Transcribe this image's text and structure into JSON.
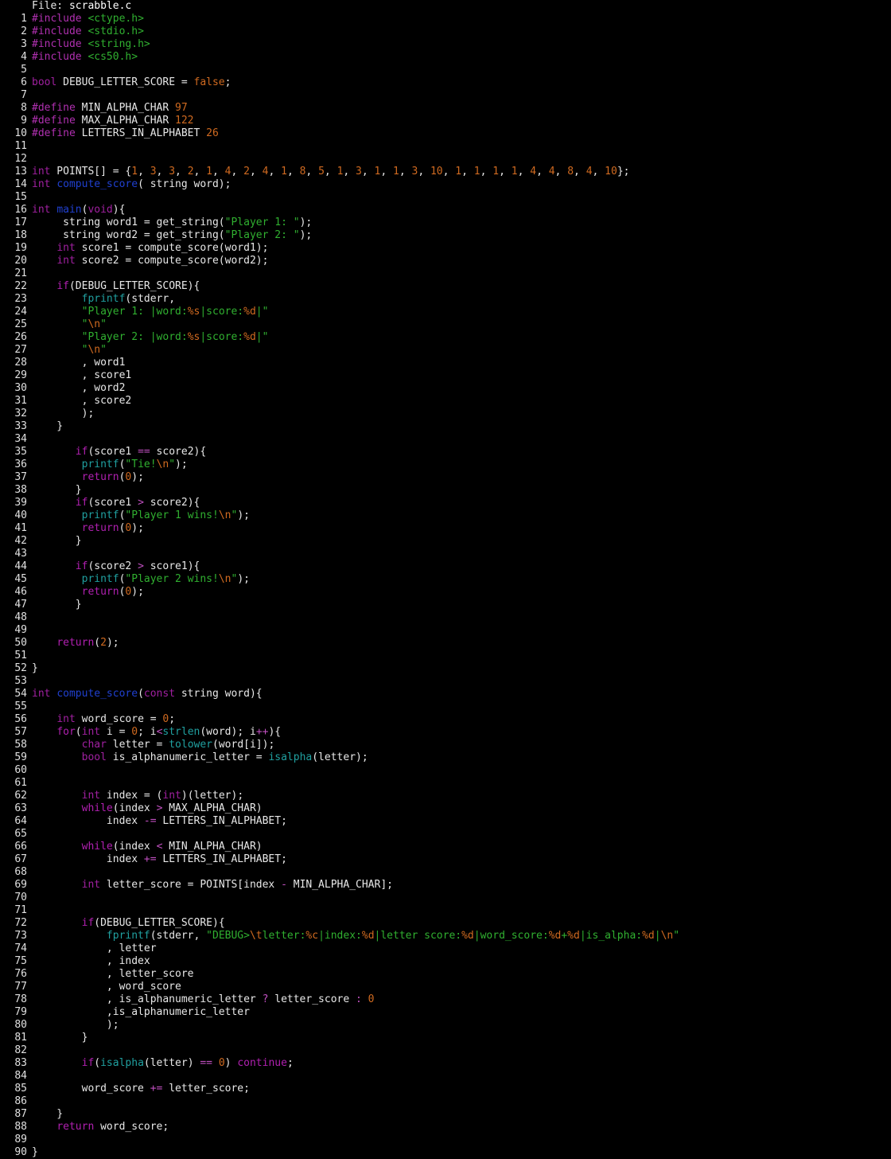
{
  "header": {
    "label": "File: ",
    "filename": "scrabble.c"
  },
  "colors": {
    "background": "#000000",
    "text": "#e8e8e8",
    "preprocessor": "#b030b0",
    "string": "#30b030",
    "number": "#d06a20",
    "type": "#a020a0",
    "function_decl": "#2040d0",
    "library_call": "#20a0a0"
  },
  "lines": [
    [
      [
        "pp",
        "#include "
      ],
      [
        "inc",
        "<ctype.h>"
      ]
    ],
    [
      [
        "pp",
        "#include "
      ],
      [
        "inc",
        "<stdio.h>"
      ]
    ],
    [
      [
        "pp",
        "#include "
      ],
      [
        "inc",
        "<string.h>"
      ]
    ],
    [
      [
        "pp",
        "#include "
      ],
      [
        "inc",
        "<cs50.h>"
      ]
    ],
    [],
    [
      [
        "type",
        "bool"
      ],
      [
        "id",
        " DEBUG_LETTER_SCORE = "
      ],
      [
        "num",
        "false"
      ],
      [
        "id",
        ";"
      ]
    ],
    [],
    [
      [
        "pp",
        "#define"
      ],
      [
        "id",
        " MIN_ALPHA_CHAR "
      ],
      [
        "num",
        "97"
      ]
    ],
    [
      [
        "pp",
        "#define"
      ],
      [
        "id",
        " MAX_ALPHA_CHAR "
      ],
      [
        "num",
        "122"
      ]
    ],
    [
      [
        "pp",
        "#define"
      ],
      [
        "id",
        " LETTERS_IN_ALPHABET "
      ],
      [
        "num",
        "26"
      ]
    ],
    [],
    [],
    [
      [
        "type",
        "int"
      ],
      [
        "id",
        " POINTS[] = {"
      ],
      [
        "num",
        "1"
      ],
      [
        "id",
        ", "
      ],
      [
        "num",
        "3"
      ],
      [
        "id",
        ", "
      ],
      [
        "num",
        "3"
      ],
      [
        "id",
        ", "
      ],
      [
        "num",
        "2"
      ],
      [
        "id",
        ", "
      ],
      [
        "num",
        "1"
      ],
      [
        "id",
        ", "
      ],
      [
        "num",
        "4"
      ],
      [
        "id",
        ", "
      ],
      [
        "num",
        "2"
      ],
      [
        "id",
        ", "
      ],
      [
        "num",
        "4"
      ],
      [
        "id",
        ", "
      ],
      [
        "num",
        "1"
      ],
      [
        "id",
        ", "
      ],
      [
        "num",
        "8"
      ],
      [
        "id",
        ", "
      ],
      [
        "num",
        "5"
      ],
      [
        "id",
        ", "
      ],
      [
        "num",
        "1"
      ],
      [
        "id",
        ", "
      ],
      [
        "num",
        "3"
      ],
      [
        "id",
        ", "
      ],
      [
        "num",
        "1"
      ],
      [
        "id",
        ", "
      ],
      [
        "num",
        "1"
      ],
      [
        "id",
        ", "
      ],
      [
        "num",
        "3"
      ],
      [
        "id",
        ", "
      ],
      [
        "num",
        "10"
      ],
      [
        "id",
        ", "
      ],
      [
        "num",
        "1"
      ],
      [
        "id",
        ", "
      ],
      [
        "num",
        "1"
      ],
      [
        "id",
        ", "
      ],
      [
        "num",
        "1"
      ],
      [
        "id",
        ", "
      ],
      [
        "num",
        "1"
      ],
      [
        "id",
        ", "
      ],
      [
        "num",
        "4"
      ],
      [
        "id",
        ", "
      ],
      [
        "num",
        "4"
      ],
      [
        "id",
        ", "
      ],
      [
        "num",
        "8"
      ],
      [
        "id",
        ", "
      ],
      [
        "num",
        "4"
      ],
      [
        "id",
        ", "
      ],
      [
        "num",
        "10"
      ],
      [
        "id",
        "};"
      ]
    ],
    [
      [
        "type",
        "int"
      ],
      [
        "id",
        " "
      ],
      [
        "fn",
        "compute_score"
      ],
      [
        "id",
        "( string word);"
      ]
    ],
    [],
    [
      [
        "type",
        "int"
      ],
      [
        "id",
        " "
      ],
      [
        "fn",
        "main"
      ],
      [
        "id",
        "("
      ],
      [
        "type",
        "void"
      ],
      [
        "id",
        "){"
      ]
    ],
    [
      [
        "id",
        "     string word1 = get_string("
      ],
      [
        "str",
        "\"Player 1: \""
      ],
      [
        "id",
        ");"
      ]
    ],
    [
      [
        "id",
        "     string word2 = get_string("
      ],
      [
        "str",
        "\"Player 2: \""
      ],
      [
        "id",
        ");"
      ]
    ],
    [
      [
        "id",
        "    "
      ],
      [
        "type",
        "int"
      ],
      [
        "id",
        " score1 = compute_score(word1);"
      ]
    ],
    [
      [
        "id",
        "    "
      ],
      [
        "type",
        "int"
      ],
      [
        "id",
        " score2 = compute_score(word2);"
      ]
    ],
    [],
    [
      [
        "id",
        "    "
      ],
      [
        "kw",
        "if"
      ],
      [
        "id",
        "(DEBUG_LETTER_SCORE){"
      ]
    ],
    [
      [
        "id",
        "        "
      ],
      [
        "lib",
        "fprintf"
      ],
      [
        "id",
        "(stderr,"
      ]
    ],
    [
      [
        "id",
        "        "
      ],
      [
        "str",
        "\"Player 1: |word:"
      ],
      [
        "esc",
        "%s"
      ],
      [
        "str",
        "|score:"
      ],
      [
        "esc",
        "%d"
      ],
      [
        "str",
        "|\""
      ]
    ],
    [
      [
        "id",
        "        "
      ],
      [
        "str",
        "\""
      ],
      [
        "esc",
        "\\n"
      ],
      [
        "str",
        "\""
      ]
    ],
    [
      [
        "id",
        "        "
      ],
      [
        "str",
        "\"Player 2: |word:"
      ],
      [
        "esc",
        "%s"
      ],
      [
        "str",
        "|score:"
      ],
      [
        "esc",
        "%d"
      ],
      [
        "str",
        "|\""
      ]
    ],
    [
      [
        "id",
        "        "
      ],
      [
        "str",
        "\""
      ],
      [
        "esc",
        "\\n"
      ],
      [
        "str",
        "\""
      ]
    ],
    [
      [
        "id",
        "        , word1"
      ]
    ],
    [
      [
        "id",
        "        , score1"
      ]
    ],
    [
      [
        "id",
        "        , word2"
      ]
    ],
    [
      [
        "id",
        "        , score2"
      ]
    ],
    [
      [
        "id",
        "        );"
      ]
    ],
    [
      [
        "id",
        "    }"
      ]
    ],
    [],
    [
      [
        "id",
        "       "
      ],
      [
        "kw",
        "if"
      ],
      [
        "id",
        "(score1 "
      ],
      [
        "op",
        "=="
      ],
      [
        "id",
        " score2){"
      ]
    ],
    [
      [
        "id",
        "        "
      ],
      [
        "lib",
        "printf"
      ],
      [
        "id",
        "("
      ],
      [
        "str",
        "\"Tie!"
      ],
      [
        "esc",
        "\\n"
      ],
      [
        "str",
        "\""
      ],
      [
        "id",
        ");"
      ]
    ],
    [
      [
        "id",
        "        "
      ],
      [
        "kw",
        "return"
      ],
      [
        "id",
        "("
      ],
      [
        "num",
        "0"
      ],
      [
        "id",
        ");"
      ]
    ],
    [
      [
        "id",
        "       }"
      ]
    ],
    [
      [
        "id",
        "       "
      ],
      [
        "kw",
        "if"
      ],
      [
        "id",
        "(score1 "
      ],
      [
        "op",
        ">"
      ],
      [
        "id",
        " score2){"
      ]
    ],
    [
      [
        "id",
        "        "
      ],
      [
        "lib",
        "printf"
      ],
      [
        "id",
        "("
      ],
      [
        "str",
        "\"Player 1 wins!"
      ],
      [
        "esc",
        "\\n"
      ],
      [
        "str",
        "\""
      ],
      [
        "id",
        ");"
      ]
    ],
    [
      [
        "id",
        "        "
      ],
      [
        "kw",
        "return"
      ],
      [
        "id",
        "("
      ],
      [
        "num",
        "0"
      ],
      [
        "id",
        ");"
      ]
    ],
    [
      [
        "id",
        "       }"
      ]
    ],
    [],
    [
      [
        "id",
        "       "
      ],
      [
        "kw",
        "if"
      ],
      [
        "id",
        "(score2 "
      ],
      [
        "op",
        ">"
      ],
      [
        "id",
        " score1){"
      ]
    ],
    [
      [
        "id",
        "        "
      ],
      [
        "lib",
        "printf"
      ],
      [
        "id",
        "("
      ],
      [
        "str",
        "\"Player 2 wins!"
      ],
      [
        "esc",
        "\\n"
      ],
      [
        "str",
        "\""
      ],
      [
        "id",
        ");"
      ]
    ],
    [
      [
        "id",
        "        "
      ],
      [
        "kw",
        "return"
      ],
      [
        "id",
        "("
      ],
      [
        "num",
        "0"
      ],
      [
        "id",
        ");"
      ]
    ],
    [
      [
        "id",
        "       }"
      ]
    ],
    [],
    [],
    [
      [
        "id",
        "    "
      ],
      [
        "kw",
        "return"
      ],
      [
        "id",
        "("
      ],
      [
        "num",
        "2"
      ],
      [
        "id",
        ");"
      ]
    ],
    [],
    [
      [
        "id",
        "}"
      ]
    ],
    [],
    [
      [
        "type",
        "int"
      ],
      [
        "id",
        " "
      ],
      [
        "fn",
        "compute_score"
      ],
      [
        "id",
        "("
      ],
      [
        "type",
        "const"
      ],
      [
        "id",
        " string word){"
      ]
    ],
    [],
    [
      [
        "id",
        "    "
      ],
      [
        "type",
        "int"
      ],
      [
        "id",
        " word_score = "
      ],
      [
        "num",
        "0"
      ],
      [
        "id",
        ";"
      ]
    ],
    [
      [
        "id",
        "    "
      ],
      [
        "kw",
        "for"
      ],
      [
        "id",
        "("
      ],
      [
        "type",
        "int"
      ],
      [
        "id",
        " i = "
      ],
      [
        "num",
        "0"
      ],
      [
        "id",
        "; i"
      ],
      [
        "op",
        "<"
      ],
      [
        "lib",
        "strlen"
      ],
      [
        "id",
        "(word); i"
      ],
      [
        "op",
        "++"
      ],
      [
        "id",
        "){"
      ]
    ],
    [
      [
        "id",
        "        "
      ],
      [
        "type",
        "char"
      ],
      [
        "id",
        " letter = "
      ],
      [
        "lib",
        "tolower"
      ],
      [
        "id",
        "(word[i]);"
      ]
    ],
    [
      [
        "id",
        "        "
      ],
      [
        "type",
        "bool"
      ],
      [
        "id",
        " is_alphanumeric_letter = "
      ],
      [
        "lib",
        "isalpha"
      ],
      [
        "id",
        "(letter);"
      ]
    ],
    [],
    [],
    [
      [
        "id",
        "        "
      ],
      [
        "type",
        "int"
      ],
      [
        "id",
        " index = ("
      ],
      [
        "type",
        "int"
      ],
      [
        "id",
        ")(letter);"
      ]
    ],
    [
      [
        "id",
        "        "
      ],
      [
        "kw",
        "while"
      ],
      [
        "id",
        "(index "
      ],
      [
        "op",
        ">"
      ],
      [
        "id",
        " MAX_ALPHA_CHAR)"
      ]
    ],
    [
      [
        "id",
        "            index "
      ],
      [
        "op",
        "-="
      ],
      [
        "id",
        " LETTERS_IN_ALPHABET;"
      ]
    ],
    [],
    [
      [
        "id",
        "        "
      ],
      [
        "kw",
        "while"
      ],
      [
        "id",
        "(index "
      ],
      [
        "op",
        "<"
      ],
      [
        "id",
        " MIN_ALPHA_CHAR)"
      ]
    ],
    [
      [
        "id",
        "            index "
      ],
      [
        "op",
        "+="
      ],
      [
        "id",
        " LETTERS_IN_ALPHABET;"
      ]
    ],
    [],
    [
      [
        "id",
        "        "
      ],
      [
        "type",
        "int"
      ],
      [
        "id",
        " letter_score = POINTS[index "
      ],
      [
        "op",
        "-"
      ],
      [
        "id",
        " MIN_ALPHA_CHAR];"
      ]
    ],
    [],
    [],
    [
      [
        "id",
        "        "
      ],
      [
        "kw",
        "if"
      ],
      [
        "id",
        "(DEBUG_LETTER_SCORE){"
      ]
    ],
    [
      [
        "id",
        "            "
      ],
      [
        "lib",
        "fprintf"
      ],
      [
        "id",
        "(stderr, "
      ],
      [
        "str",
        "\"DEBUG>"
      ],
      [
        "esc",
        "\\t"
      ],
      [
        "str",
        "letter:"
      ],
      [
        "esc",
        "%c"
      ],
      [
        "str",
        "|index:"
      ],
      [
        "esc",
        "%d"
      ],
      [
        "str",
        "|letter score:"
      ],
      [
        "esc",
        "%d"
      ],
      [
        "str",
        "|word_score:"
      ],
      [
        "esc",
        "%d"
      ],
      [
        "str",
        "+"
      ],
      [
        "esc",
        "%d"
      ],
      [
        "str",
        "|is_alpha:"
      ],
      [
        "esc",
        "%d"
      ],
      [
        "str",
        "|"
      ],
      [
        "esc",
        "\\n"
      ],
      [
        "str",
        "\""
      ]
    ],
    [
      [
        "id",
        "            , letter"
      ]
    ],
    [
      [
        "id",
        "            , index"
      ]
    ],
    [
      [
        "id",
        "            , letter_score"
      ]
    ],
    [
      [
        "id",
        "            , word_score"
      ]
    ],
    [
      [
        "id",
        "            , is_alphanumeric_letter "
      ],
      [
        "op",
        "?"
      ],
      [
        "id",
        " letter_score "
      ],
      [
        "op",
        ":"
      ],
      [
        "id",
        " "
      ],
      [
        "num",
        "0"
      ]
    ],
    [
      [
        "id",
        "            ,is_alphanumeric_letter"
      ]
    ],
    [
      [
        "id",
        "            );"
      ]
    ],
    [
      [
        "id",
        "        }"
      ]
    ],
    [],
    [
      [
        "id",
        "        "
      ],
      [
        "kw",
        "if"
      ],
      [
        "id",
        "("
      ],
      [
        "lib",
        "isalpha"
      ],
      [
        "id",
        "(letter) "
      ],
      [
        "op",
        "=="
      ],
      [
        "id",
        " "
      ],
      [
        "num",
        "0"
      ],
      [
        "id",
        ") "
      ],
      [
        "kw",
        "continue"
      ],
      [
        "id",
        ";"
      ]
    ],
    [],
    [
      [
        "id",
        "        word_score "
      ],
      [
        "op",
        "+="
      ],
      [
        "id",
        " letter_score;"
      ]
    ],
    [],
    [
      [
        "id",
        "    }"
      ]
    ],
    [
      [
        "id",
        "    "
      ],
      [
        "kw",
        "return"
      ],
      [
        "id",
        " word_score;"
      ]
    ],
    [],
    [
      [
        "id",
        "}"
      ]
    ]
  ]
}
